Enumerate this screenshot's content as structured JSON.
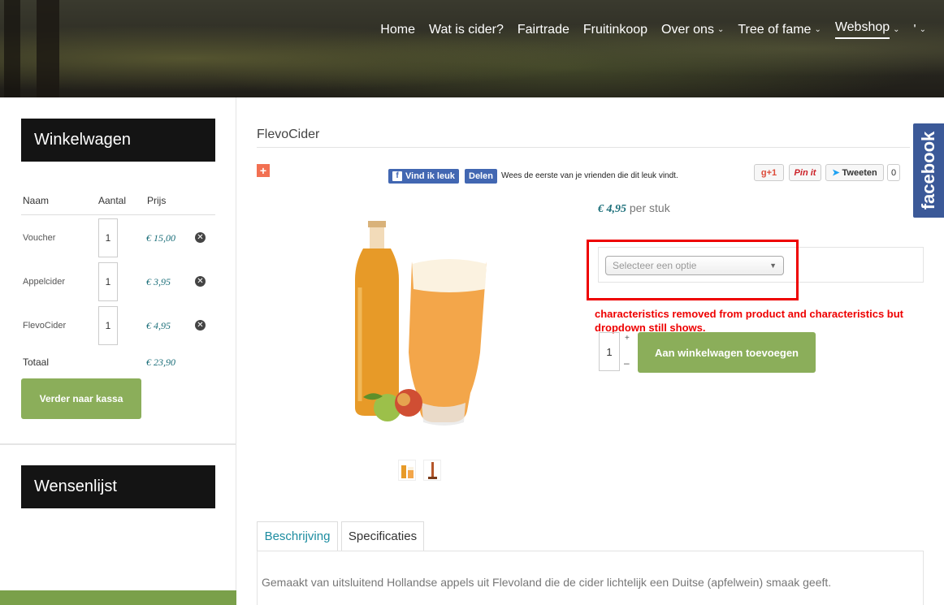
{
  "nav": {
    "items": [
      {
        "label": "Home"
      },
      {
        "label": "Wat is cider?"
      },
      {
        "label": "Fairtrade"
      },
      {
        "label": "Fruitinkoop"
      },
      {
        "label": "Over ons"
      },
      {
        "label": "Tree of fame"
      },
      {
        "label": "Webshop"
      },
      {
        "label": "'"
      }
    ]
  },
  "sidebar": {
    "cart_title": "Winkelwagen",
    "headers": {
      "name": "Naam",
      "qty": "Aantal",
      "price": "Prijs"
    },
    "rows": [
      {
        "name": "Voucher",
        "qty": "1",
        "price": "€ 15,00"
      },
      {
        "name": "Appelcider",
        "qty": "1",
        "price": "€ 3,95"
      },
      {
        "name": "FlevoCider",
        "qty": "1",
        "price": "€ 4,95"
      }
    ],
    "total_label": "Totaal",
    "total_value": "€ 23,90",
    "checkout_button": "Verder naar kassa",
    "wishlist_title": "Wensenlijst"
  },
  "product": {
    "title": "FlevoCider",
    "price": "€ 4,95",
    "price_unit": "per stuk",
    "select_placeholder": "Selecteer een optie",
    "qty": "1",
    "qty_plus": "+",
    "qty_minus": "–",
    "add_to_cart": "Aan winkelwagen toevoegen",
    "annotation": "characteristics removed from product and characteristics but dropdown still shows."
  },
  "social": {
    "fb_like": "Vind ik leuk",
    "fb_share": "Delen",
    "fb_text": "Wees de eerste van je vrienden die dit leuk vindt.",
    "gplus": "g+1",
    "pinit": "Pin it",
    "tweet": "Tweeten",
    "tweet_count": "0",
    "facebook_tab": "facebook"
  },
  "tabs": [
    {
      "label": "Beschrijving"
    },
    {
      "label": "Specificaties"
    }
  ],
  "description": "Gemaakt van uitsluitend Hollandse appels uit Flevoland die de cider lichtelijk een Duitse (apfelwein) smaak geeft.",
  "colors": {
    "accent_green": "#8bae5a",
    "price_teal": "#1c6f7a",
    "annotation_red": "#ee0000",
    "facebook_blue": "#3b5998"
  }
}
